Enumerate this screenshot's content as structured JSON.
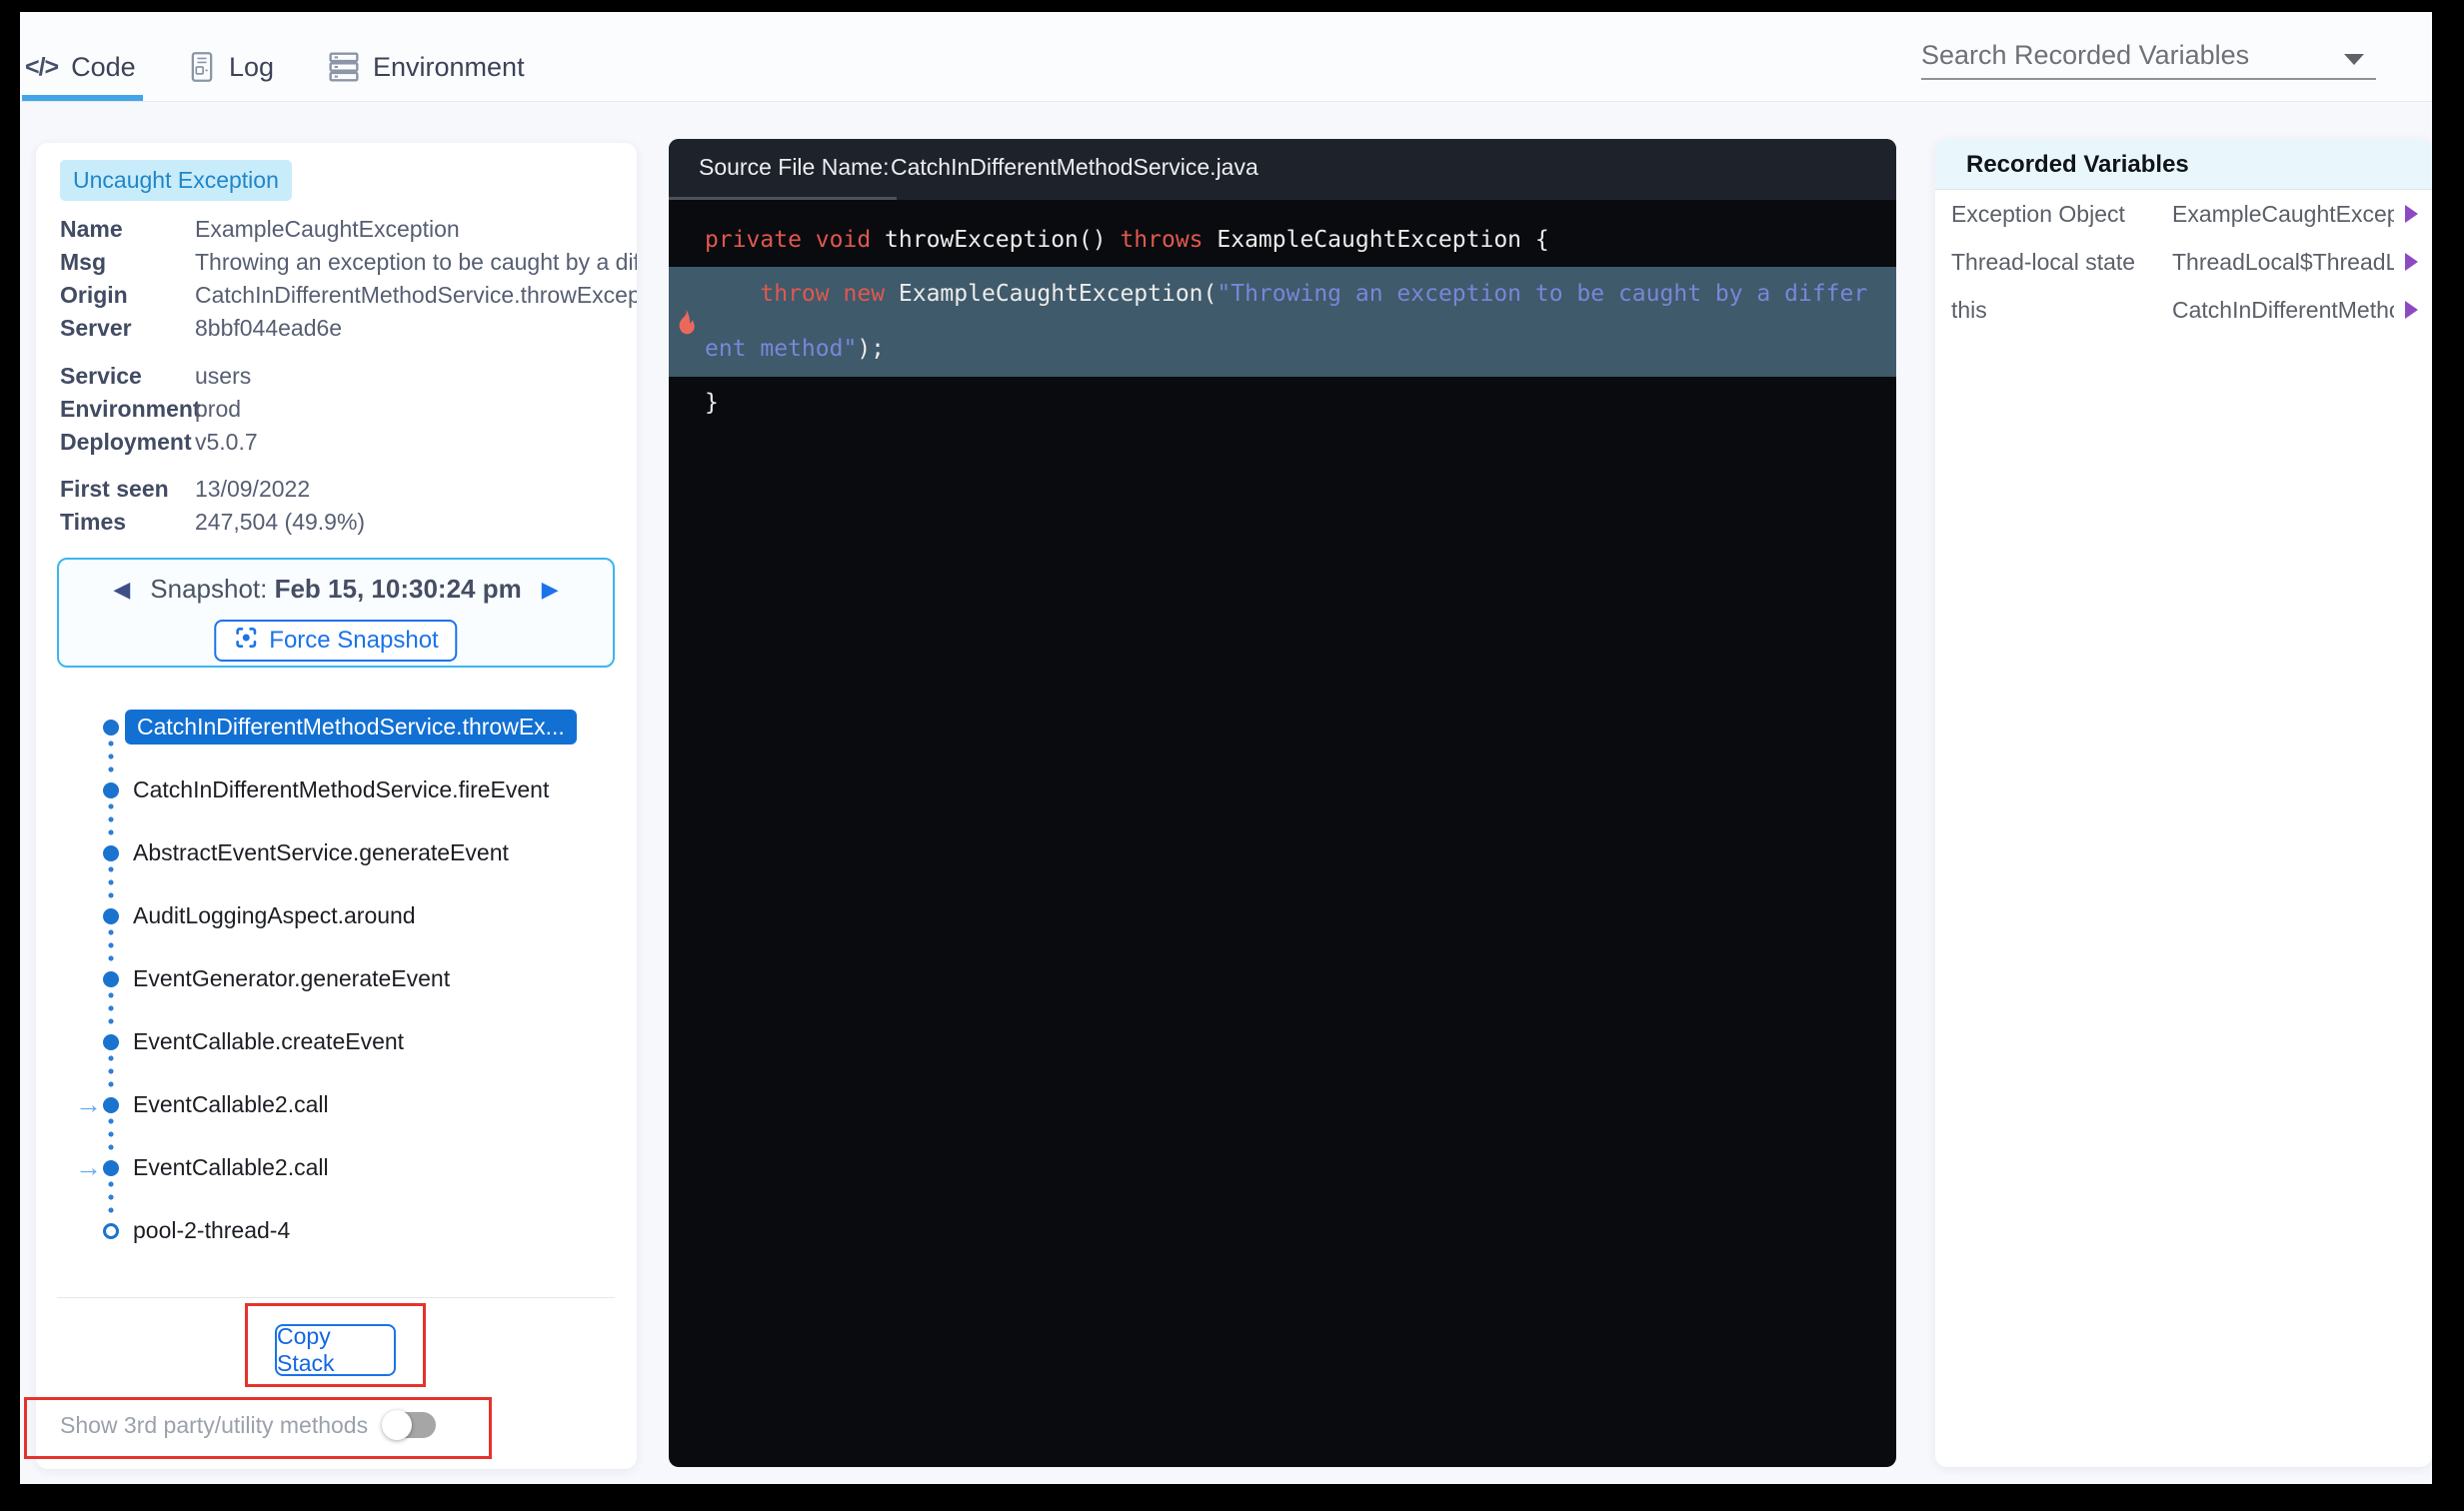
{
  "tabs": {
    "code_icon": "</>",
    "code": "Code",
    "log": "Log",
    "environment": "Environment"
  },
  "search": {
    "label": "Search Recorded Variables"
  },
  "exception": {
    "badge": "Uncaught Exception",
    "details1": [
      {
        "label": "Name",
        "value": "ExampleCaughtException"
      },
      {
        "label": "Msg",
        "value": "Throwing an exception to be caught by a dif"
      },
      {
        "label": "Origin",
        "value": "CatchInDifferentMethodService.throwExcep"
      },
      {
        "label": "Server",
        "value": "8bbf044ead6e"
      }
    ],
    "details2": [
      {
        "label": "Service",
        "value": "users"
      },
      {
        "label": "Environment",
        "value": "prod"
      },
      {
        "label": "Deployment",
        "value": "v5.0.7"
      }
    ],
    "details3": [
      {
        "label": "First seen",
        "value": "13/09/2022"
      },
      {
        "label": "Times",
        "value": "247,504 (49.9%)"
      }
    ]
  },
  "snapshot": {
    "prev_icon": "◀",
    "label": "Snapshot:",
    "timestamp": "Feb 15, 10:30:24 pm",
    "next_icon": "▶",
    "force_button": "Force Snapshot"
  },
  "stack": {
    "arrow_icon": "→",
    "items": [
      {
        "label": "CatchInDifferentMethodService.throwEx..."
      },
      {
        "label": "CatchInDifferentMethodService.fireEvent"
      },
      {
        "label": "AbstractEventService.generateEvent"
      },
      {
        "label": "AuditLoggingAspect.around"
      },
      {
        "label": "EventGenerator.generateEvent"
      },
      {
        "label": "EventCallable.createEvent"
      },
      {
        "label": "EventCallable2.call"
      },
      {
        "label": "EventCallable2.call"
      },
      {
        "label": "pool-2-thread-4"
      }
    ],
    "copy_button": "Copy Stack",
    "toggle_label": "Show 3rd party/utility methods"
  },
  "editor": {
    "header_label": "Source File Name:",
    "file_name": "CatchInDifferentMethodService.java",
    "code": {
      "l1": {
        "k1": "private",
        "s1": " ",
        "k2": "void",
        "p1": " throwException() ",
        "k3": "throws",
        "p2": " ExampleCaughtException {"
      },
      "l2a": {
        "ind": "    ",
        "k1": "throw",
        "s1": " ",
        "k2": "new",
        "p1": " ExampleCaughtException(",
        "str": "\"Throwing an exception to be caught by a differ"
      },
      "l2b": {
        "str": "ent method\"",
        "p1": ");"
      },
      "l3": {
        "p1": "}"
      }
    }
  },
  "recorded": {
    "title": "Recorded Variables",
    "rows": [
      {
        "name": "Exception Object",
        "value": "ExampleCaughtExcept..."
      },
      {
        "name": "Thread-local state",
        "value": "ThreadLocal$ThreadL..."
      },
      {
        "name": "this",
        "value": "CatchInDifferentMetho..."
      }
    ]
  },
  "colors": {
    "accent_blue": "#1a73cf",
    "tab_underline": "#41a5e8",
    "badge_bg": "#c9ecfb",
    "badge_text": "#2086c8",
    "snapshot_border": "#3cb5f0",
    "annotation_red": "#e5332c",
    "purple_arrow": "#8d49c2",
    "code_keyword": "#e0584e",
    "code_string": "#7a86d8",
    "code_highlight_bg": "#3f5a6b",
    "editor_bg": "#0a0b0e",
    "editor_header_bg": "#1e222b"
  }
}
